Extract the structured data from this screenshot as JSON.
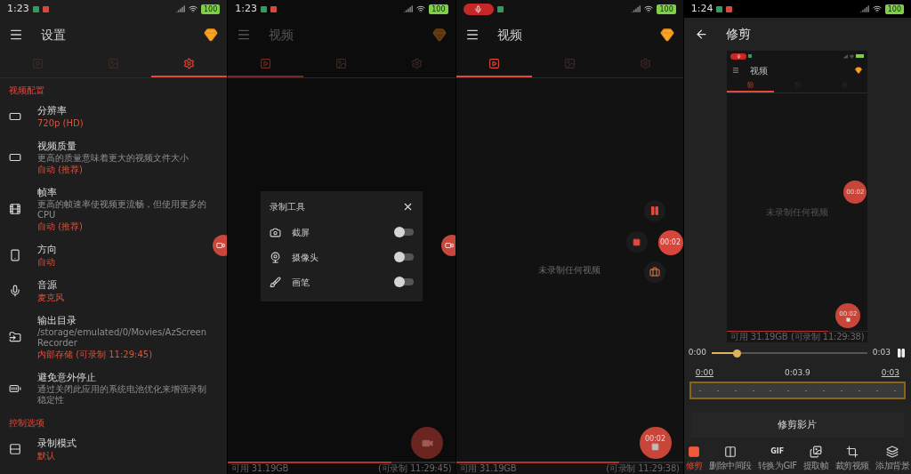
{
  "screens": [
    {
      "kind": "settings",
      "dimmed": false,
      "floating_bubble": true,
      "status_bar": {
        "time": "1:23",
        "recording": false,
        "battery": "100"
      },
      "app_bar": {
        "title": "设置"
      },
      "tabs": [
        {
          "selected": false
        },
        {
          "selected": false
        },
        {
          "selected": true
        }
      ],
      "sections": [
        {
          "title": "视频配置",
          "items": [
            {
              "title": "分辨率",
              "value": "720p (HD)"
            },
            {
              "title": "视频质量",
              "description": "更高的质量意味着更大的视频文件大小",
              "value": "自动 (推荐)"
            },
            {
              "title": "帧率",
              "description": "更高的帧速率使视频更流畅，但使用更多的 CPU",
              "value": "自动 (推荐)"
            },
            {
              "title": "方向",
              "value": "自动"
            },
            {
              "title": "音源",
              "value": "麦克风"
            },
            {
              "title": "输出目录",
              "description": "/storage/emulated/0/Movies/AzScreenRecorder",
              "value": "内部存储 (可录制 11:29:45)"
            },
            {
              "title": "避免意外停止",
              "description": "通过关闭此应用的系统电池优化来增强录制稳定性"
            }
          ]
        },
        {
          "title": "控制选项",
          "items": [
            {
              "title": "录制模式",
              "value": "默认"
            }
          ]
        }
      ]
    },
    {
      "kind": "video",
      "dimmed": true,
      "floating_bubble": true,
      "status_bar": {
        "time": "1:23",
        "recording": false,
        "battery": "100"
      },
      "app_bar": {
        "title": "视频"
      },
      "tabs": [
        {
          "selected": true
        },
        {
          "selected": false
        },
        {
          "selected": false
        }
      ],
      "dialog": {
        "title": "录制工具",
        "tools": [
          {
            "label": "截屏",
            "on": false
          },
          {
            "label": "摄像头",
            "on": false
          },
          {
            "label": "画笔",
            "on": false
          }
        ]
      },
      "fab": {
        "recording": false
      },
      "storage": {
        "level": 0.72,
        "free": "可用 31.19GB",
        "remaining": "(可录制 11:29:45)"
      }
    },
    {
      "kind": "video",
      "dimmed": false,
      "floating_bubble": false,
      "status_bar": {
        "recording": true,
        "battery": "100"
      },
      "app_bar": {
        "title": "视频"
      },
      "tabs": [
        {
          "selected": true
        },
        {
          "selected": false
        },
        {
          "selected": false
        }
      ],
      "empty_text": "未录制任何视频",
      "recording_controls": {
        "timer": "00:02"
      },
      "fab": {
        "recording": true,
        "timer": "00:02"
      },
      "storage": {
        "level": 0.72,
        "free": "可用 31.19GB",
        "remaining": "(可录制 11:29:38)"
      }
    },
    {
      "kind": "trim",
      "status_bar": {
        "time": "1:24",
        "recording": false,
        "battery": "100"
      },
      "app_bar": {
        "title": "修剪"
      },
      "preview": {
        "title": "视频",
        "tabs": [
          {
            "selected": true
          },
          {
            "selected": false
          },
          {
            "selected": false
          }
        ],
        "empty_text": "未录制任何视频",
        "bubble_timer": "00:02",
        "fab_timer": "00:02",
        "storage": {
          "level": 0.72,
          "free": "可用 31.19GB",
          "remaining": "(可录制 11:29:38)"
        }
      },
      "player": {
        "start": "0:00",
        "end": "0:03",
        "level": 0.16
      },
      "trim": {
        "start": "0:00",
        "duration": "0:03.9",
        "end": "0:03"
      },
      "action": "修剪影片",
      "tools": [
        {
          "label": "修剪",
          "selected": true
        },
        {
          "label": "删除中间段",
          "selected": false
        },
        {
          "label": "转换为GIF",
          "badge": "GIF",
          "selected": false
        },
        {
          "label": "提取帧",
          "selected": false
        },
        {
          "label": "裁剪视频",
          "selected": false
        },
        {
          "label": "添加背景",
          "selected": false
        }
      ]
    }
  ]
}
